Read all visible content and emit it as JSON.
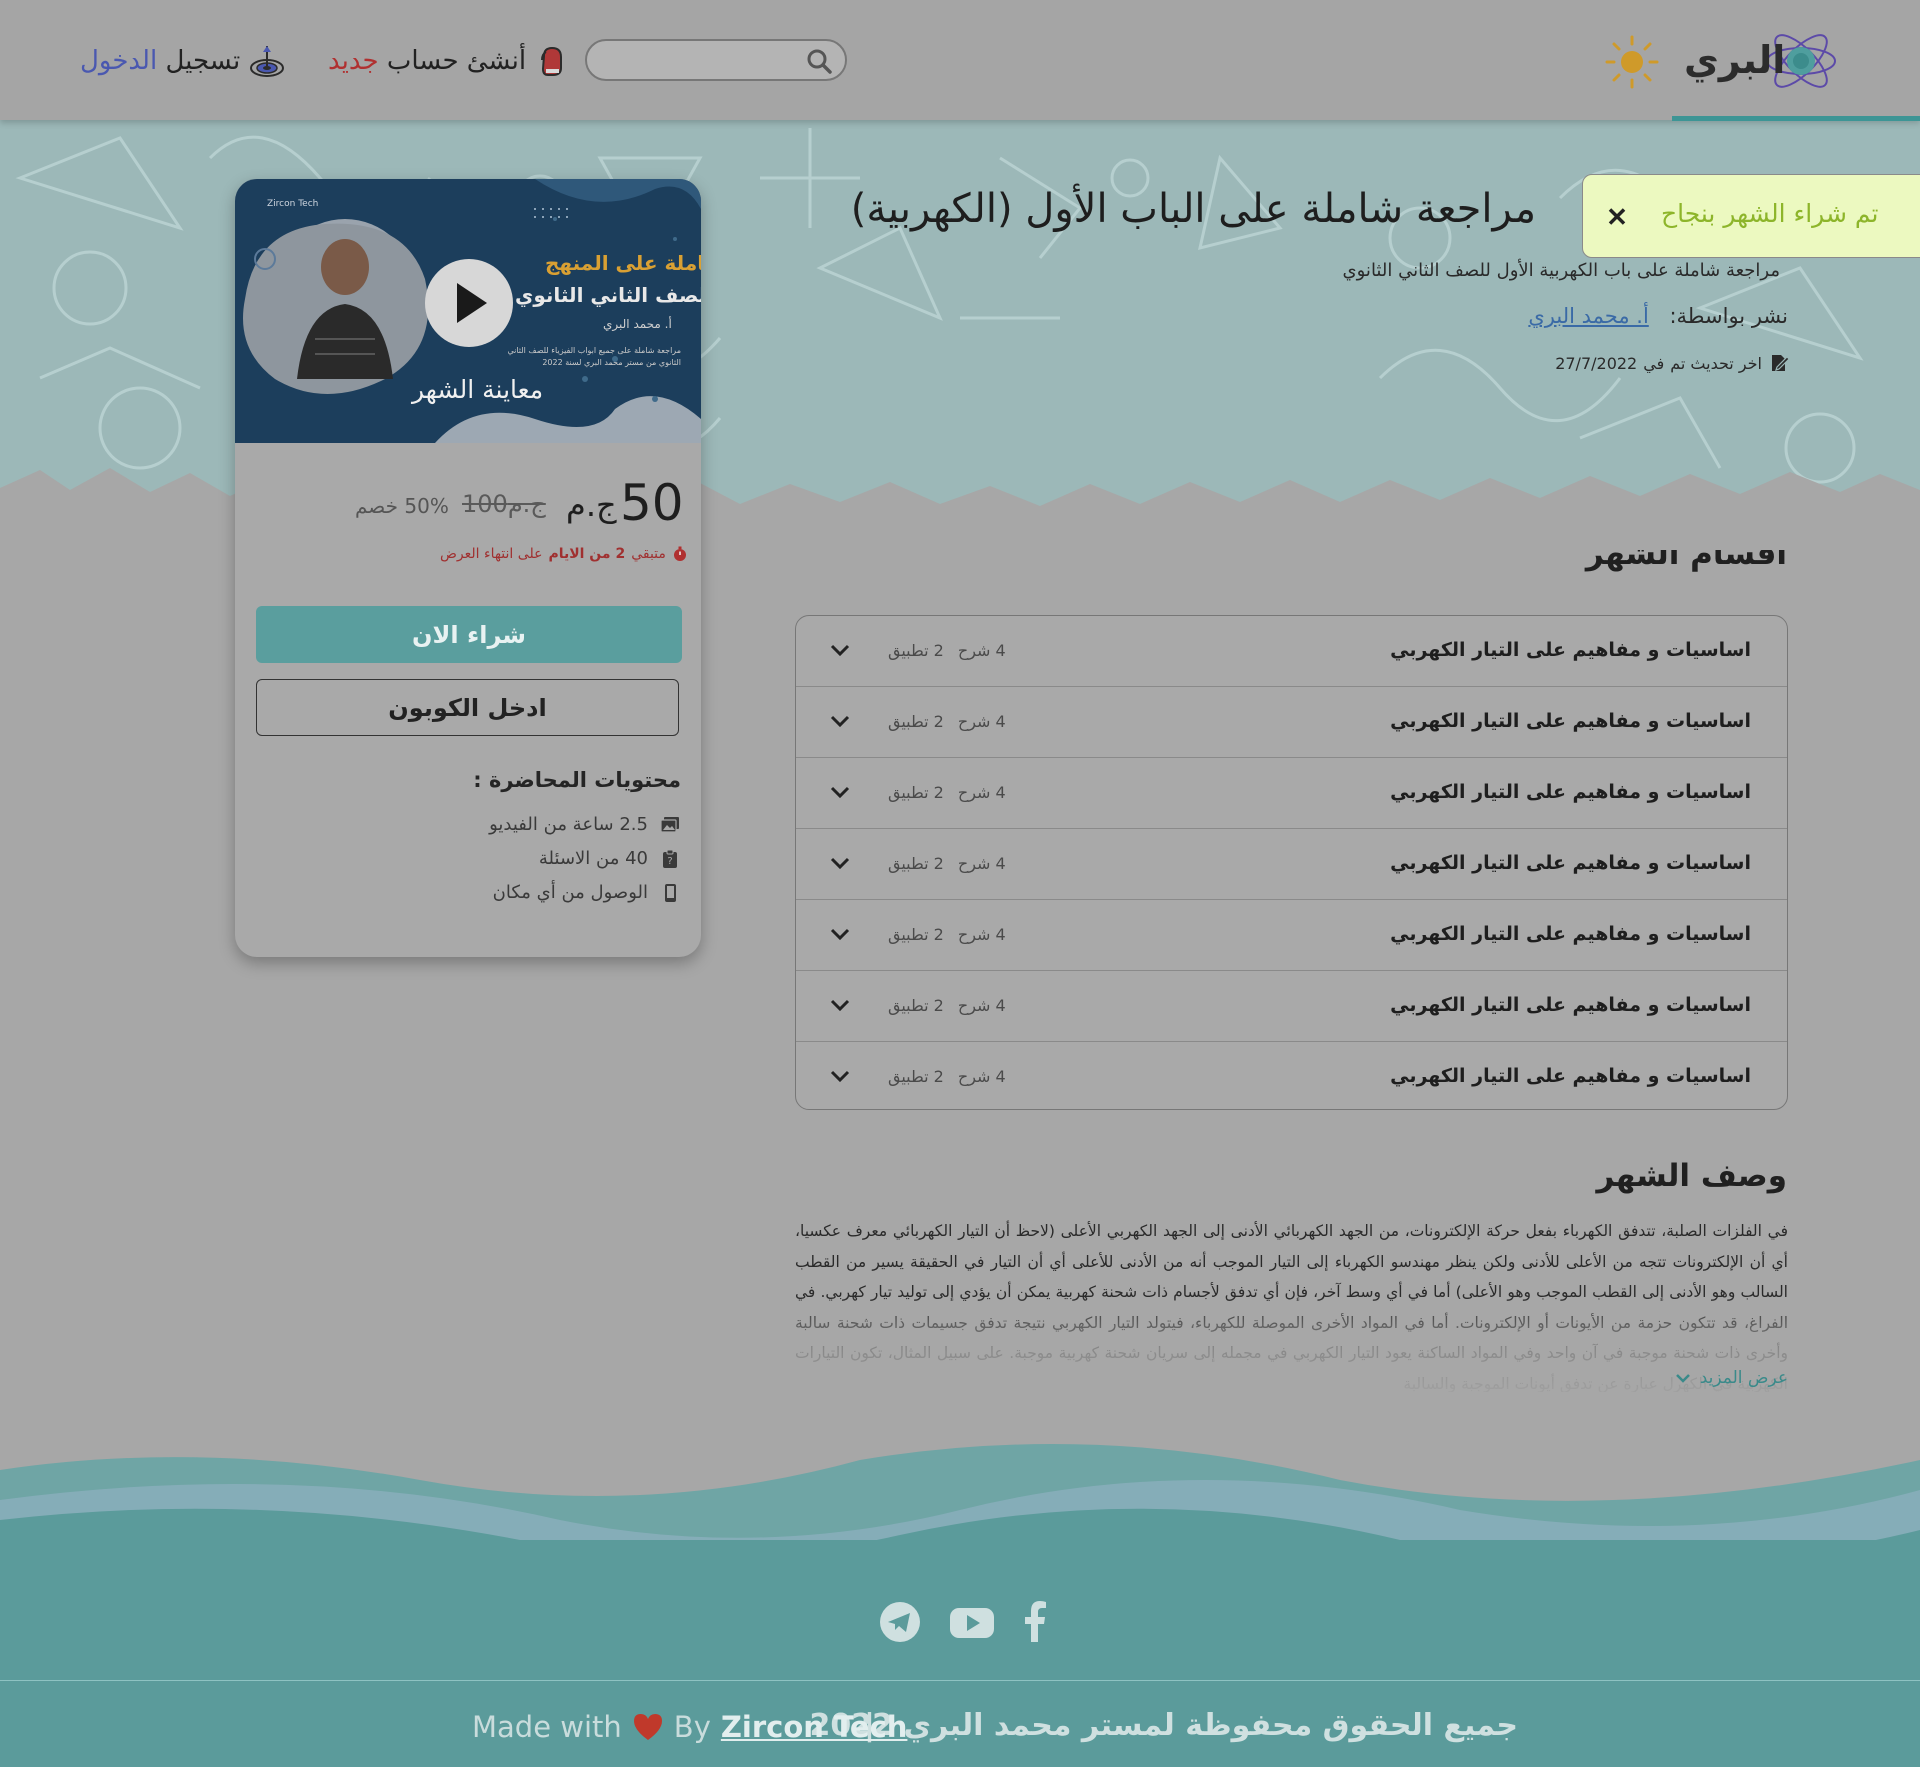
{
  "header": {
    "brand_name": "البري",
    "search": {
      "placeholder": "",
      "value": ""
    },
    "register": {
      "prefix": "أنشئ حساب ",
      "accent": "جديد"
    },
    "login": {
      "prefix": "تسجيل ",
      "accent": "الدخول"
    },
    "icons": {
      "logo": "atom-logo-icon",
      "theme": "sun-icon",
      "search": "search-icon",
      "register": "boxing-glove-icon",
      "login": "target-icon"
    }
  },
  "toast": {
    "message": "تم شراء الشهر بنجاح",
    "close_label": "✕",
    "background": "#ecf9c0",
    "text_color": "#8db52a"
  },
  "hero": {
    "title": "مراجعة شاملة على الباب الأول (الكهربية)",
    "subtitle": "مراجعة شاملة على باب الكهربية الأول للصف الثاني الثانوي",
    "published_label": "نشر بواسطة:",
    "author": "أ. محمد البري",
    "updated_label": "اخر تحديث تم",
    "updated_in": "في",
    "updated_date": "27/7/2022"
  },
  "price_card": {
    "thumbnail": {
      "title_line1": "مراجعة شاملة على المنهج",
      "title_line2": "للصف الثاني الثانوي",
      "teacher": "أ. محمد البري",
      "description": "مراجعة شاملة على جميع ابواب الفيزياء للصف الثاني الثانوي من مستر محمد البري لسنة 2022",
      "brand": "Zircon Tech"
    },
    "preview_label": "معاينة الشهر",
    "current_price": "50",
    "currency": "ج.م",
    "old_price": "100",
    "old_currency": "ج.م",
    "discount": "50% خصم",
    "timer": {
      "prefix": "متبقي",
      "days": "2 من الايام",
      "suffix": "على انتهاء العرض"
    },
    "buy_label": "شراء الان",
    "coupon_label": "ادخل الكوبون",
    "contents_heading": "محتويات المحاضرة :",
    "contents": [
      {
        "text": "2.5 ساعة من الفيديو",
        "icon": "video-library-icon"
      },
      {
        "text": "40 من الاسئلة",
        "icon": "clipboard-icon"
      },
      {
        "text": "الوصول من أي مكان",
        "icon": "mobile-icon"
      }
    ]
  },
  "sections": {
    "heading": "اقسام الشهر",
    "items": [
      {
        "title": "اساسيات و مفاهيم على التيار الكهربي",
        "explain": "4 شرح",
        "apply": "2 تطبيق"
      },
      {
        "title": "اساسيات و مفاهيم على التيار الكهربي",
        "explain": "4 شرح",
        "apply": "2 تطبيق"
      },
      {
        "title": "اساسيات و مفاهيم على التيار الكهربي",
        "explain": "4 شرح",
        "apply": "2 تطبيق"
      },
      {
        "title": "اساسيات و مفاهيم على التيار الكهربي",
        "explain": "4 شرح",
        "apply": "2 تطبيق"
      },
      {
        "title": "اساسيات و مفاهيم على التيار الكهربي",
        "explain": "4 شرح",
        "apply": "2 تطبيق"
      },
      {
        "title": "اساسيات و مفاهيم على التيار الكهربي",
        "explain": "4 شرح",
        "apply": "2 تطبيق"
      },
      {
        "title": "اساسيات و مفاهيم على التيار الكهربي",
        "explain": "4 شرح",
        "apply": "2 تطبيق"
      }
    ]
  },
  "description": {
    "heading": "وصف الشهر",
    "text": "في الفلزات الصلبة، تتدفق الكهرباء بفعل حركة الإلكترونات، من الجهد الكهربائي الأدنى إلى الجهد الكهربي الأعلى (لاحظ أن التيار الكهربائي معرف عكسيا، أي أن الإلكترونات تتجه من الأعلى للأدنى ولكن ينظر مهندسو الكهرباء إلى التيار الموجب أنه من الأدنى للأعلى أي أن التيار في الحقيقة يسير من القطب السالب وهو الأدنى إلى القطب الموجب وهو الأعلى) أما في أي وسط آخر، فإن أي تدفق لأجسام ذات شحنة كهربية يمكن أن يؤدي إلى توليد تيار كهربي. في الفراغ، قد تتكون حزمة من الأيونات أو الإلكترونات. أما في المواد الأخرى الموصلة للكهرباء، فيتولد التيار الكهربي نتيجة تدفق جسيمات ذات شحنة سالبة وأخرى ذات شحنة موجبة في آن واحد وفي المواد الساكنة يعود التيار الكهربي في مجمله إلى سريان شحنة كهربية موجبة. على سبيل المثال، تكون التيارات الكهربية في الكهرل عبارة عن تدفق أيونات الموجبة والسالبة",
    "show_more": "عرض المزيد"
  },
  "footer": {
    "copyright": "جميع الحقوق محفوظة لمستر محمد البري 2022",
    "separator": "|",
    "made_with": "Made with",
    "by": "By",
    "company": "Zircon Tech",
    "social": [
      "telegram-icon",
      "youtube-icon",
      "facebook-icon"
    ]
  },
  "colors": {
    "teal": "#5b9b9b",
    "buy_button": "#5a9e9e",
    "toast_bg": "#ecf9c0",
    "accent_red": "#b03030",
    "accent_blue": "#4a58b0",
    "link_blue": "#3a6aa6"
  }
}
